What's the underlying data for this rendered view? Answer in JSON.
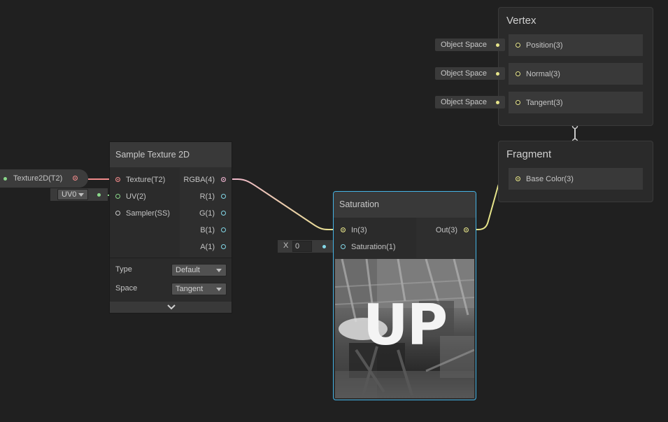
{
  "vertex": {
    "title": "Vertex",
    "slots": [
      {
        "label": "Position(3)",
        "space": "Object Space"
      },
      {
        "label": "Normal(3)",
        "space": "Object Space"
      },
      {
        "label": "Tangent(3)",
        "space": "Object Space"
      }
    ]
  },
  "fragment": {
    "title": "Fragment",
    "slots": [
      {
        "label": "Base Color(3)"
      }
    ]
  },
  "texture_property": {
    "label": "Texture2D(T2)"
  },
  "uv_dropdown": {
    "value": "UV0"
  },
  "sample_node": {
    "title": "Sample Texture 2D",
    "inputs": [
      "Texture(T2)",
      "UV(2)",
      "Sampler(SS)"
    ],
    "outputs": [
      "RGBA(4)",
      "R(1)",
      "G(1)",
      "B(1)",
      "A(1)"
    ],
    "type_label": "Type",
    "type_value": "Default",
    "space_label": "Space",
    "space_value": "Tangent"
  },
  "saturation_node": {
    "title": "Saturation",
    "inputs": [
      "In(3)",
      "Saturation(1)"
    ],
    "outputs": [
      "Out(3)"
    ],
    "preview_text": "UP"
  },
  "saturation_input": {
    "axis": "X",
    "value": "0"
  },
  "colors": {
    "wire_vector": "#e6e48a",
    "wire_texture": "#f08a8a",
    "wire_rgba_start": "#f0b4d0",
    "wire_uv": "#8ad88a",
    "wire_float": "#84d8e8",
    "selection": "#44b4e6"
  }
}
